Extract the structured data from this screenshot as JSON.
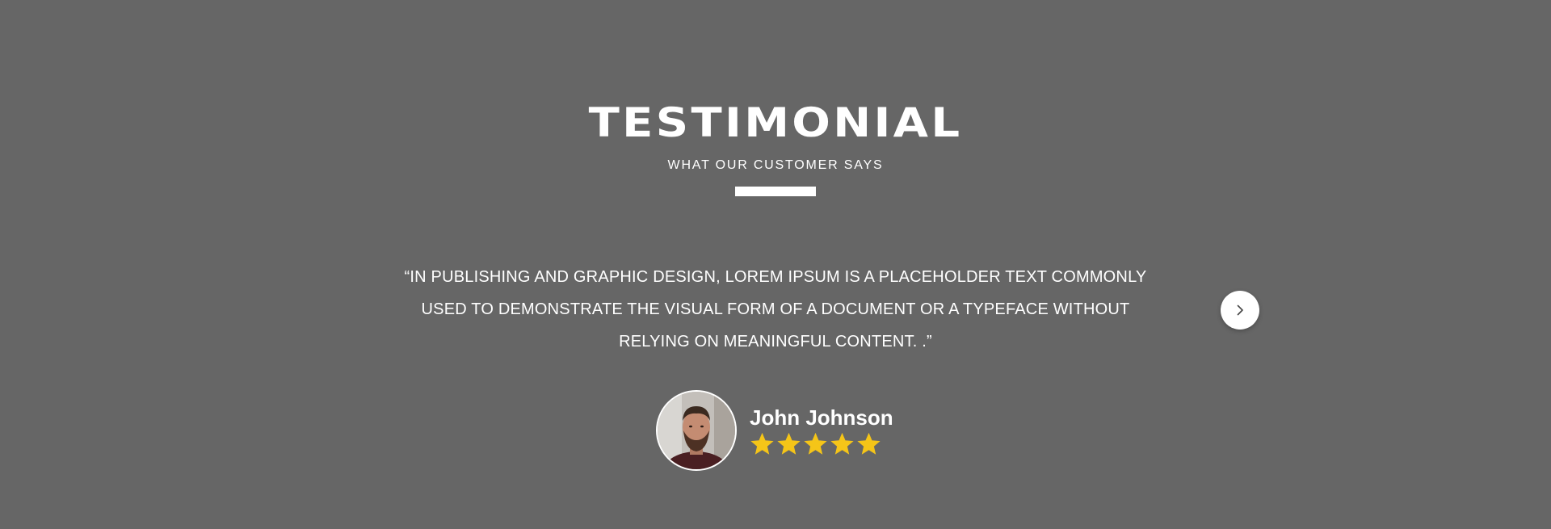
{
  "testimonial": {
    "title": "TESTIMONIAL",
    "subtitle": "WHAT OUR CUSTOMER SAYS",
    "quote": "“IN PUBLISHING AND GRAPHIC DESIGN, LOREM IPSUM IS A PLACEHOLDER TEXT COMMONLY USED TO DEMONSTRATE THE VISUAL FORM OF A DOCUMENT OR A TYPEFACE WITHOUT RELYING ON MEANINGFUL CONTENT.  .”",
    "customer_name": "John Johnson",
    "rating": 5,
    "rating_max": 5,
    "next_icon": "chevron-right-icon"
  },
  "colors": {
    "background": "#666666",
    "text": "#ffffff",
    "star": "#f5c518",
    "button": "#ffffff",
    "chevron": "#444444"
  }
}
